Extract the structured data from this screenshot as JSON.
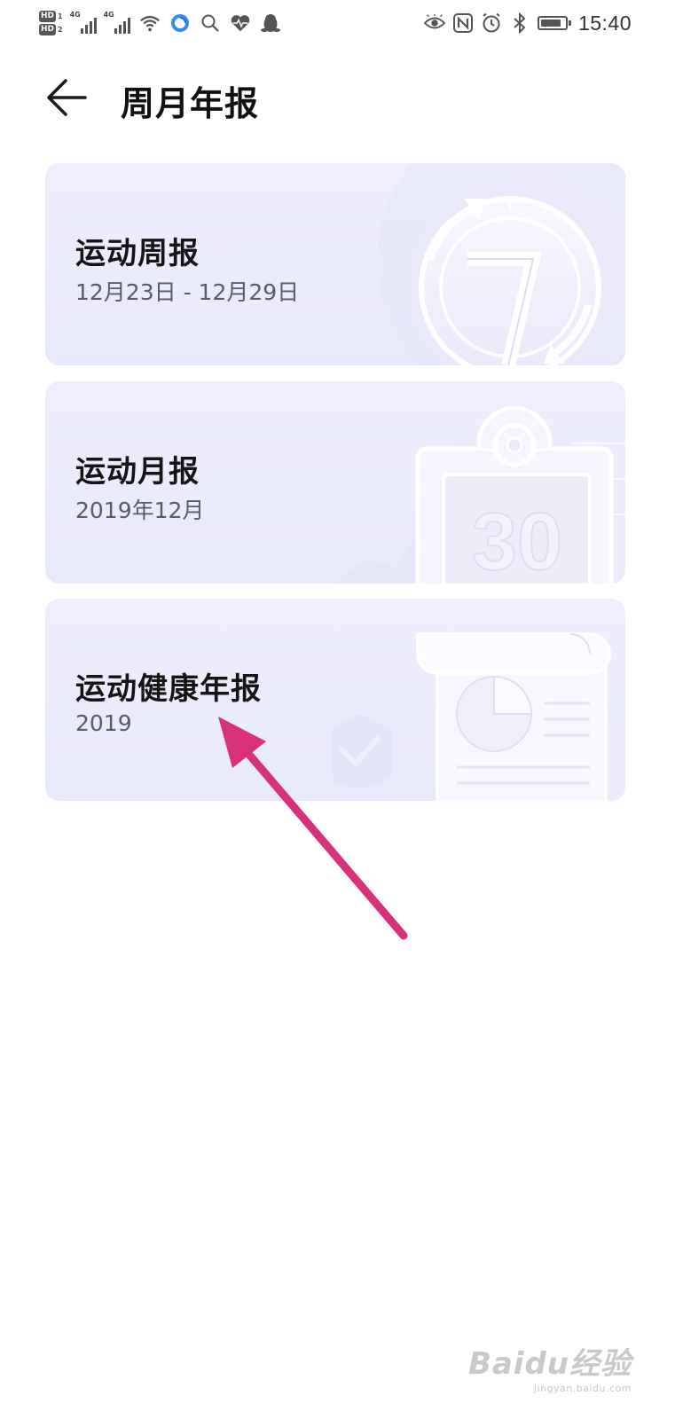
{
  "status_bar": {
    "hd1": "HD",
    "hd1_sub": "1",
    "hd2": "HD",
    "hd2_sub": "2",
    "net1": "4G",
    "net2": "4G",
    "time": "15:40",
    "left_icons": [
      "hd-badge-icon",
      "signal-icon",
      "signal-icon",
      "wifi-icon",
      "browser-icon",
      "search-icon",
      "health-heart-icon",
      "qq-penguin-icon"
    ],
    "right_icons": [
      "eye-icon",
      "nfc-icon",
      "alarm-icon",
      "bluetooth-icon",
      "battery-icon"
    ]
  },
  "header": {
    "back_icon": "arrow-left-icon",
    "title": "周月年报"
  },
  "cards": [
    {
      "title": "运动周报",
      "subtitle": "12月23日 - 12月29日",
      "art": "weekly-cycle-7-icon"
    },
    {
      "title": "运动月报",
      "subtitle": "2019年12月",
      "art": "monthly-clipboard-30-icon"
    },
    {
      "title": "运动健康年报",
      "subtitle": "2019",
      "art": "yearly-report-scroll-icon"
    }
  ],
  "annotation": {
    "color": "#d8307a"
  },
  "watermark": {
    "main": "Baidu经验",
    "sub": "jingyan.baidu.com"
  },
  "colors": {
    "card_bg": "#ececfc",
    "title": "#111111",
    "subtitle": "#5a5a6a"
  }
}
